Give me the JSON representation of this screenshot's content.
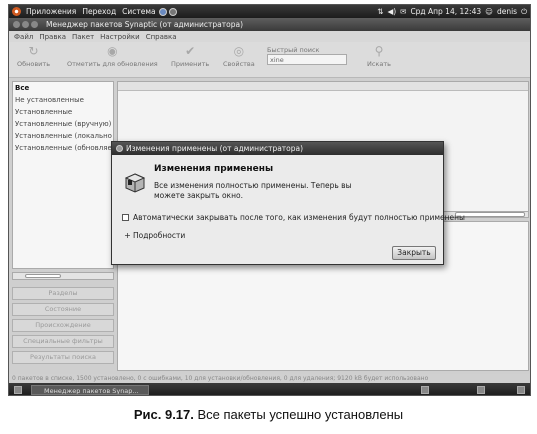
{
  "top_panel": {
    "menus": [
      "Приложения",
      "Переход",
      "Система"
    ],
    "clock": "Срд Апр 14, 12:43",
    "user": "denis"
  },
  "window": {
    "title": "Менеджер пакетов Synaptic  (от администратора)"
  },
  "menubar": [
    "Файл",
    "Правка",
    "Пакет",
    "Настройки",
    "Справка"
  ],
  "toolbar": {
    "reload": "Обновить",
    "mark_all": "Отметить для обновления",
    "apply": "Применить",
    "properties": "Свойства",
    "quick_search_label": "Быстрый поиск",
    "quick_search_value": "xine",
    "search": "Искать"
  },
  "filters": [
    "Все",
    "Не установленные",
    "Установленные",
    "Установленные (вручную)",
    "Установленные (локально или устаревшие)",
    "Установленные (обновляемые)"
  ],
  "side_buttons": [
    "Разделы",
    "Состояние",
    "Происхождение",
    "Специальные фильтры",
    "Результаты поиска"
  ],
  "statusbar": "0 пакетов в списке, 1500 установлено, 0 с ошибками, 10 для установки/обновления, 0 для удаления; 9120 kB будет использовано",
  "taskbar": {
    "item": "Менеджер пакетов Synap..."
  },
  "dialog": {
    "title": "Изменения применены (от администратора)",
    "heading": "Изменения применены",
    "text": "Все изменения полностью применены. Теперь вы можете закрыть окно.",
    "auto_close": "Автоматически закрывать после того, как изменения будут полностью применены",
    "details": "Подробности",
    "close_button": "Закрыть"
  },
  "caption": {
    "figure": "Рис. 9.17.",
    "text": "Все пакеты успешно установлены"
  }
}
